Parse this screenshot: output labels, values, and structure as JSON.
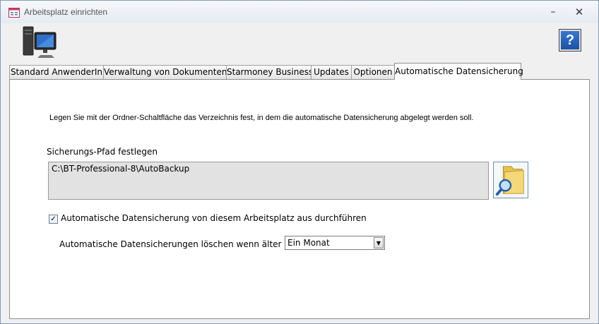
{
  "window": {
    "title": "Arbeitsplatz einrichten",
    "minimize_glyph": "–",
    "close_glyph": "✕"
  },
  "header": {
    "computer_icon": "computer-icon",
    "help_label": "?"
  },
  "tabs": [
    {
      "label": "Standard AnwenderIn",
      "active": false
    },
    {
      "label": "Verwaltung von Dokumenten",
      "active": false
    },
    {
      "label": "Starmoney Business",
      "active": false
    },
    {
      "label": "Updates",
      "active": false
    },
    {
      "label": "Optionen",
      "active": false
    },
    {
      "label": "Automatische Datensicherung",
      "active": true
    }
  ],
  "panel": {
    "info": "Legen Sie mit der Ordner-Schaltfläche das Verzeichnis fest, in dem die automatische Datensicherung abgelegt werden soll.",
    "path_label": "Sicherungs-Pfad festlegen",
    "path_value": "C:\\BT-Professional-8\\AutoBackup",
    "auto_backup_checked": true,
    "auto_backup_label": "Automatische Datensicherung von diesem Arbeitsplatz aus durchführen",
    "delete_label": "Automatische Datensicherungen löschen wenn älter als:",
    "delete_selected": "Ein Monat"
  },
  "colors": {
    "accent": "#1a4fa0",
    "field_bg": "#e2e2e2"
  }
}
